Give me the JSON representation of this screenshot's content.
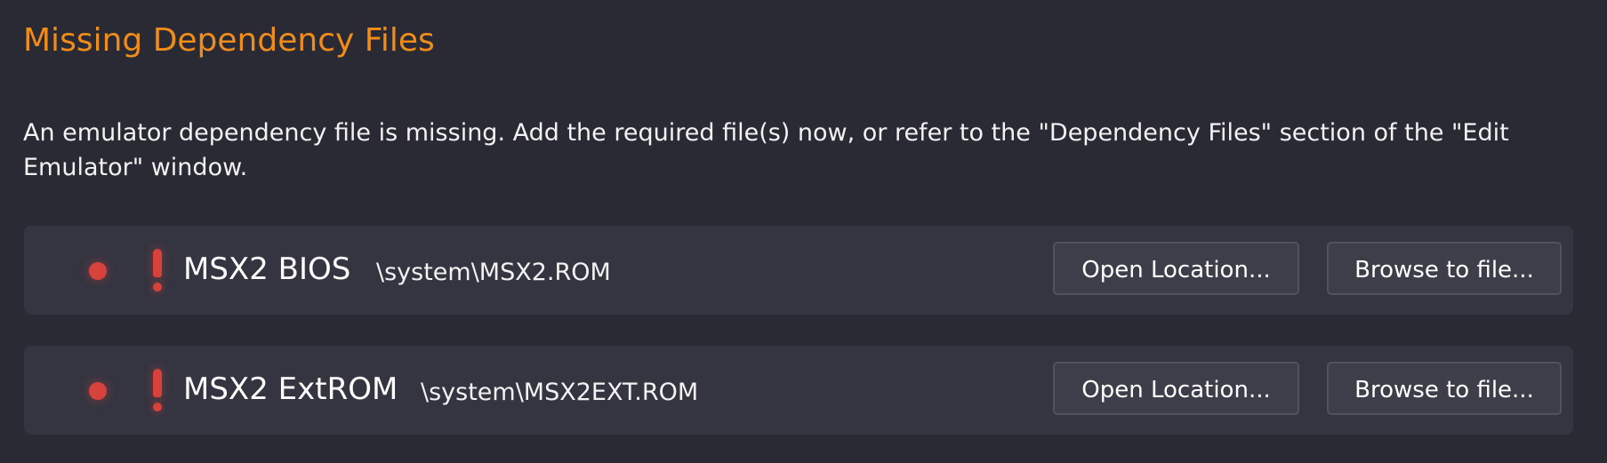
{
  "header": {
    "title": "Missing Dependency Files"
  },
  "description": "An emulator dependency file is missing. Add the required file(s) now, or refer to the \"Dependency Files\" section of the \"Edit Emulator\" window.",
  "colors": {
    "title": "#f08c1a",
    "background": "#2a2a35",
    "row_background": "#343541",
    "status_red": "#d8423c",
    "button_background": "#3d3e4a",
    "button_border": "#51525e"
  },
  "dependencies": [
    {
      "status_icon": "status-dot-icon",
      "warning_icon": "exclamation-icon",
      "name": "MSX2 BIOS",
      "path": "\\system\\MSX2.ROM",
      "open_label": "Open Location...",
      "browse_label": "Browse to file..."
    },
    {
      "status_icon": "status-dot-icon",
      "warning_icon": "exclamation-icon",
      "name": "MSX2 ExtROM",
      "path": "\\system\\MSX2EXT.ROM",
      "open_label": "Open Location...",
      "browse_label": "Browse to file..."
    }
  ]
}
